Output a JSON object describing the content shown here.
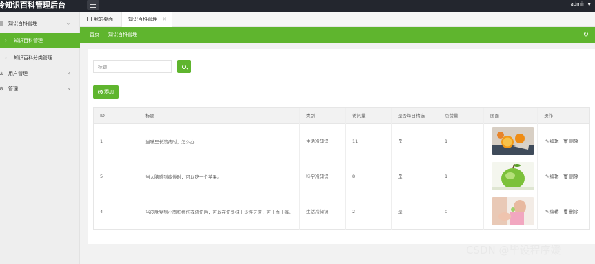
{
  "app": {
    "title": "冷知识百科管理后台",
    "user": "admin"
  },
  "sidebar": {
    "items": [
      {
        "label": "知识百科管理",
        "icon": "book-icon"
      },
      {
        "label": "知识百科管理",
        "active": true
      },
      {
        "label": "知识百科分类管理"
      },
      {
        "label": "用户管理",
        "icon": "user-icon"
      },
      {
        "label": "管理",
        "icon": "gear-icon"
      }
    ]
  },
  "tabs": [
    {
      "label": "我的桌面",
      "icon": "home-icon"
    },
    {
      "label": "知识百科管理",
      "active": true
    }
  ],
  "breadcrumb": {
    "home": "首页",
    "current": "知识百科管理"
  },
  "search": {
    "placeholder": "标题"
  },
  "buttons": {
    "add": "添加"
  },
  "table": {
    "columns": [
      "ID",
      "标题",
      "类别",
      "访问量",
      "是否每日精选",
      "点赞量",
      "图面",
      "操作"
    ],
    "rows": [
      {
        "id": "1",
        "title": "当嘴里长溃疡时，怎么办",
        "category": "生活冷知识",
        "views": "11",
        "daily": "是",
        "likes": "1",
        "image": "orange-slices"
      },
      {
        "id": "5",
        "title": "当大脑感到疲倦时，可以吃一个苹果。",
        "category": "科学冷知识",
        "views": "8",
        "daily": "是",
        "likes": "1",
        "image": "green-apple"
      },
      {
        "id": "4",
        "title": "当皮肤受到小面积擦伤或烧伤后，可以在伤处抹上少许牙膏，可止血止痛。",
        "category": "生活冷知识",
        "views": "2",
        "daily": "是",
        "likes": "0",
        "image": "hands-care"
      }
    ],
    "actions": {
      "edit": "编辑",
      "delete": "删除"
    }
  },
  "watermark": "CSDN @毕设程序媛",
  "colors": {
    "accent": "#5fb52e",
    "topbar": "#23262e"
  }
}
